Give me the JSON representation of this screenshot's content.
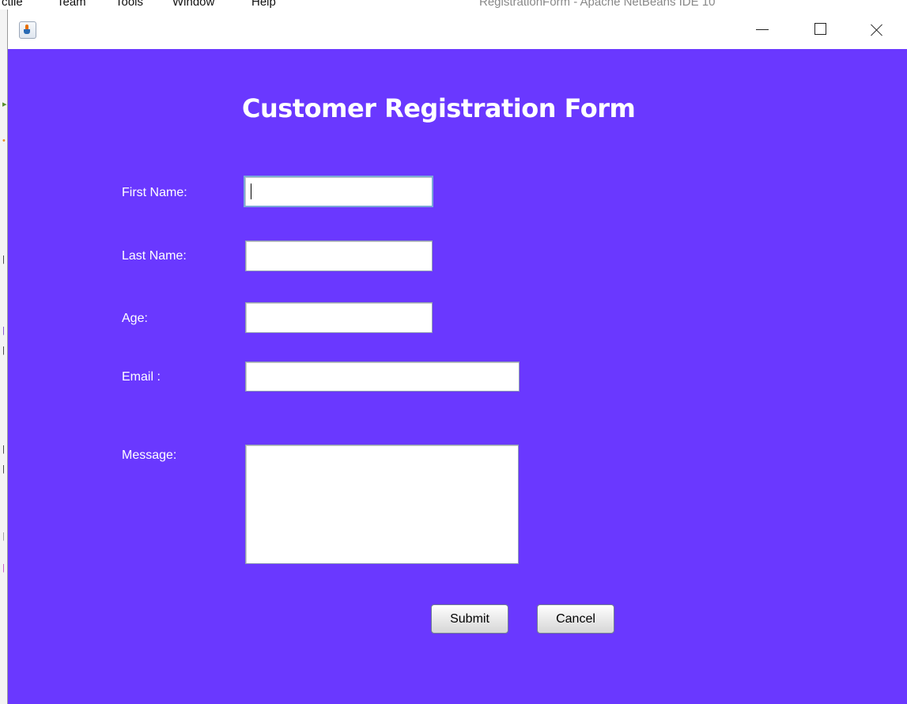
{
  "ide": {
    "menu": [
      "ctile",
      "Team",
      "Tools",
      "Window",
      "Help"
    ],
    "title": "RegistrationForm - Apache NetBeans IDE 10"
  },
  "window": {
    "icon": "java-cup-icon",
    "controls": [
      "minimize-icon",
      "maximize-icon",
      "close-icon"
    ]
  },
  "form": {
    "title": "Customer Registration Form",
    "labels": {
      "first_name": "First Name:",
      "last_name": "Last Name:",
      "age": "Age:",
      "email": "Email :",
      "message": "Message:"
    },
    "values": {
      "first_name": "",
      "last_name": "",
      "age": "",
      "email": "",
      "message": ""
    },
    "buttons": {
      "submit": "Submit",
      "cancel": "Cancel"
    }
  },
  "colors": {
    "background": "#6a38ff",
    "label_text": "#ffffff",
    "field_focus_border": "#7aa7d8"
  }
}
